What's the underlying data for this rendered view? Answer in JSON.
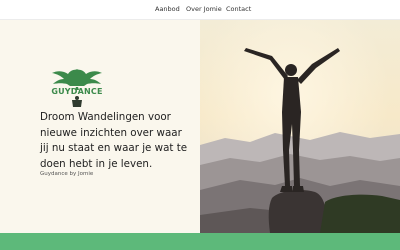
{
  "nav": {
    "items": [
      "Aanbod",
      "Over Jomie",
      "Contact"
    ]
  },
  "hero": {
    "logo_text": "GUYDANCE",
    "headline": "Droom Wandelingen voor nieuwe inzichten over waar jij nu staat en waar je wat te doen hebt in je leven.",
    "byline": "Guydance by Jomie",
    "image_icon": "person-arms-raised-on-mountain-silhouette"
  },
  "colors": {
    "brand_green": "#3c8a4b",
    "band_green": "#5db97a",
    "hero_bg": "#faf7ed"
  }
}
